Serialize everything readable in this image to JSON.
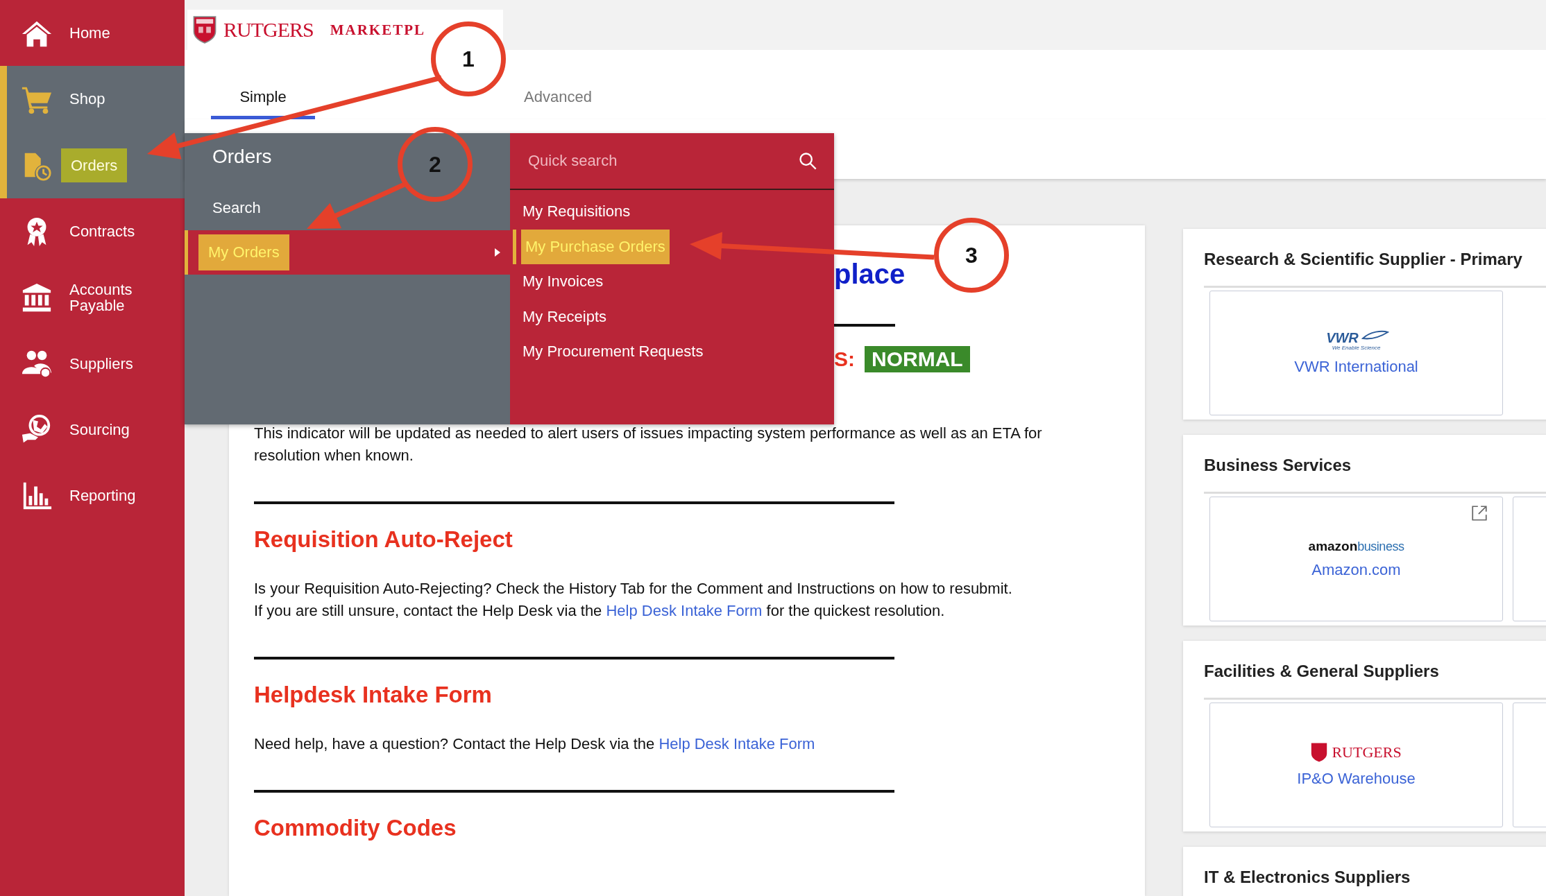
{
  "header": {
    "logo_primary": "RUTGERS",
    "logo_secondary": "MARKETPL"
  },
  "sidebar": {
    "items": [
      {
        "label": "Home",
        "selected": false,
        "highlighted": false
      },
      {
        "label": "Shop",
        "selected": true,
        "highlighted": false
      },
      {
        "label": "Orders",
        "selected": true,
        "highlighted": true
      },
      {
        "label": "Contracts",
        "selected": false,
        "highlighted": false
      },
      {
        "label": "Accounts Payable",
        "selected": false,
        "highlighted": false
      },
      {
        "label": "Suppliers",
        "selected": false,
        "highlighted": false
      },
      {
        "label": "Sourcing",
        "selected": false,
        "highlighted": false
      },
      {
        "label": "Reporting",
        "selected": false,
        "highlighted": false
      }
    ]
  },
  "tabs": [
    {
      "label": "Simple",
      "selected": true
    },
    {
      "label": "Advanced",
      "selected": false
    }
  ],
  "flyout": {
    "title": "Orders",
    "items": [
      {
        "label": "Search",
        "selected": false,
        "highlighted": false,
        "has_submenu": false
      },
      {
        "label": "My Orders",
        "selected": true,
        "highlighted": true,
        "has_submenu": true
      }
    ],
    "submenu": {
      "search": {
        "placeholder": "Quick search"
      },
      "items": [
        {
          "label": "My Requisitions",
          "selected": false,
          "highlighted": false
        },
        {
          "label": "My Purchase Orders",
          "selected": true,
          "highlighted": true
        },
        {
          "label": "My Invoices",
          "selected": false,
          "highlighted": false
        },
        {
          "label": "My Receipts",
          "selected": false,
          "highlighted": false
        },
        {
          "label": "My Procurement Requests",
          "selected": false,
          "highlighted": false
        }
      ]
    }
  },
  "content": {
    "heading_fragment": "place",
    "status_fragment": "S:",
    "status_badge": "NORMAL",
    "indicator_text": "This indicator will be updated as needed to alert users of issues impacting system performance as well as an ETA for resolution when known.",
    "sections": [
      {
        "title": "Requisition Auto-Reject",
        "text": "Is your Requisition Auto-Rejecting? Check the History Tab for the Comment and Instructions on how to resubmit.",
        "text2": "If you are still unsure, contact the Help Desk via the",
        "link": "Help Desk Intake Form",
        "text3": "for the quickest resolution."
      },
      {
        "title": "Helpdesk Intake Form",
        "text2": "Need help, have a question? Contact the Help Desk via the",
        "link": "Help Desk Intake Form"
      },
      {
        "title": "Commodity Codes"
      }
    ]
  },
  "supplier_groups": [
    {
      "title": "Research & Scientific Supplier - Primary",
      "suppliers": [
        {
          "kind": "vwr",
          "logo_text": "VWR",
          "logo_tagline": "We Enable Science",
          "name": "VWR International",
          "external": false
        }
      ]
    },
    {
      "title": "Business Services",
      "suppliers": [
        {
          "kind": "amazon",
          "logo_text": "amazon",
          "logo_tagline": "business",
          "name": "Amazon.com",
          "external": true
        }
      ]
    },
    {
      "title": "Facilities & General Suppliers",
      "suppliers": [
        {
          "kind": "rutgers",
          "logo_text": "RUTGERS",
          "name": "IP&O Warehouse",
          "external": false
        }
      ]
    },
    {
      "title": "IT & Electronics Suppliers"
    }
  ],
  "annotations": [
    {
      "label": "1"
    },
    {
      "label": "2"
    },
    {
      "label": "3"
    }
  ]
}
